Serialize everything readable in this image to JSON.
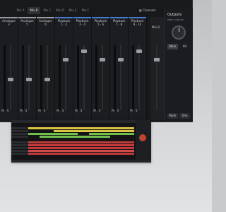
{
  "mixer": {
    "tabs": [
      {
        "label": "Mix A",
        "active": false
      },
      {
        "label": "Mix B",
        "active": true
      },
      {
        "label": "Mix C",
        "active": false
      },
      {
        "label": "Mix D",
        "active": false
      },
      {
        "label": "Mix E",
        "active": false
      },
      {
        "label": "Mix F",
        "active": false
      }
    ],
    "channels_label": "Channels",
    "strips": [
      {
        "name": "Analogue",
        "num": "3",
        "color": "#9a9ca1"
      },
      {
        "name": "Analogue",
        "num": "5",
        "color": "#9a9ca1"
      },
      {
        "name": "Analogue",
        "num": "6",
        "color": "#9a9ca1"
      },
      {
        "name": "Playback",
        "num": "1 - 2",
        "color": "#4a7bd0"
      },
      {
        "name": "Playback",
        "num": "3 - 4",
        "color": "#4a7bd0"
      },
      {
        "name": "Playback",
        "num": "5 - 6",
        "color": "#4a7bd0"
      },
      {
        "name": "Playback",
        "num": "7 - 8",
        "color": "#4a7bd0"
      },
      {
        "name": "Playback",
        "num": "9 - 10",
        "color": "#4a7bd0"
      }
    ],
    "strip_buttons": [
      "M",
      "S",
      "M",
      "S"
    ],
    "master_label": "Mix B"
  },
  "outputs": {
    "title": "Outputs",
    "subtitle": "Main outputs",
    "main_label": "Main",
    "alt_label": "Alt",
    "mute_label": "Mute",
    "dim_label": "Dim"
  }
}
